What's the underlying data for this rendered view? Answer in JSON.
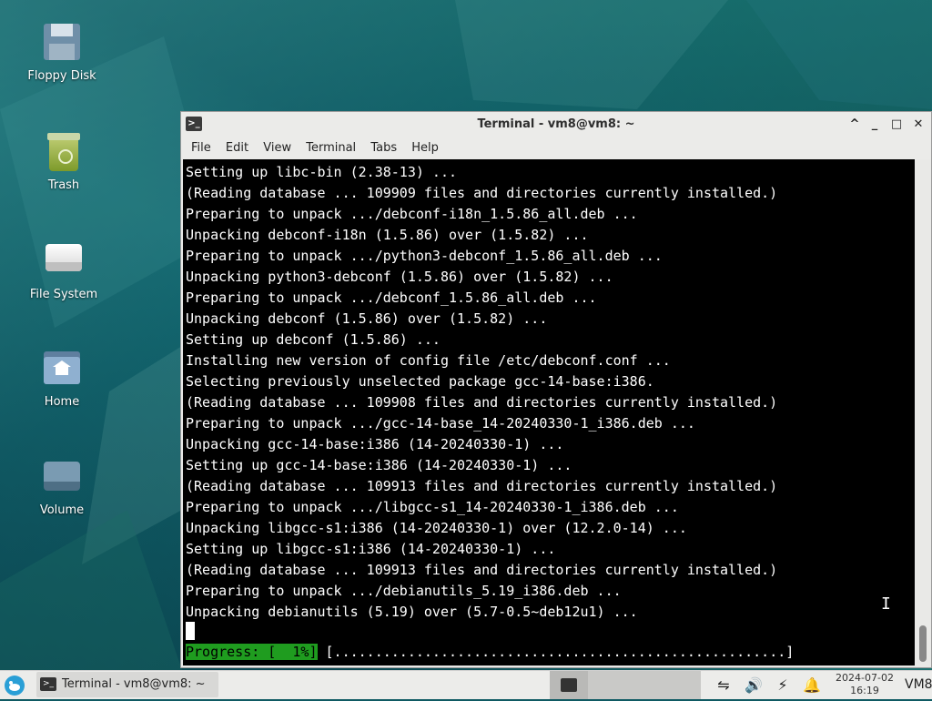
{
  "desktop": {
    "icons": [
      {
        "label": "Floppy Disk"
      },
      {
        "label": "Trash"
      },
      {
        "label": "File System"
      },
      {
        "label": "Home"
      },
      {
        "label": "Volume"
      }
    ]
  },
  "window": {
    "title": "Terminal - vm8@vm8: ~",
    "controls": [
      "^",
      "_",
      "□",
      "✕"
    ],
    "menu": [
      "File",
      "Edit",
      "View",
      "Terminal",
      "Tabs",
      "Help"
    ]
  },
  "terminal": {
    "lines": [
      "Setting up libc-bin (2.38-13) ...",
      "(Reading database ... 109909 files and directories currently installed.)",
      "Preparing to unpack .../debconf-i18n_1.5.86_all.deb ...",
      "Unpacking debconf-i18n (1.5.86) over (1.5.82) ...",
      "Preparing to unpack .../python3-debconf_1.5.86_all.deb ...",
      "Unpacking python3-debconf (1.5.86) over (1.5.82) ...",
      "Preparing to unpack .../debconf_1.5.86_all.deb ...",
      "Unpacking debconf (1.5.86) over (1.5.82) ...",
      "Setting up debconf (1.5.86) ...",
      "Installing new version of config file /etc/debconf.conf ...",
      "Selecting previously unselected package gcc-14-base:i386.",
      "(Reading database ... 109908 files and directories currently installed.)",
      "Preparing to unpack .../gcc-14-base_14-20240330-1_i386.deb ...",
      "Unpacking gcc-14-base:i386 (14-20240330-1) ...",
      "Setting up gcc-14-base:i386 (14-20240330-1) ...",
      "(Reading database ... 109913 files and directories currently installed.)",
      "Preparing to unpack .../libgcc-s1_14-20240330-1_i386.deb ...",
      "Unpacking libgcc-s1:i386 (14-20240330-1) over (12.2.0-14) ...",
      "Setting up libgcc-s1:i386 (14-20240330-1) ...",
      "(Reading database ... 109913 files and directories currently installed.)",
      "Preparing to unpack .../debianutils_5.19_i386.deb ...",
      "Unpacking debianutils (5.19) over (5.7-0.5~deb12u1) ..."
    ],
    "progress_label": "Progress: [  1%]",
    "progress_bar": "[.......................................................]",
    "progress_percent": 1
  },
  "taskbar": {
    "task_label": "Terminal - vm8@vm8: ~",
    "date": "2024-07-02",
    "time": "16:19",
    "host": "VM8"
  },
  "colors": {
    "progress_green": "#1f9c1f",
    "terminal_bg": "#000000",
    "terminal_fg": "#ffffff"
  }
}
